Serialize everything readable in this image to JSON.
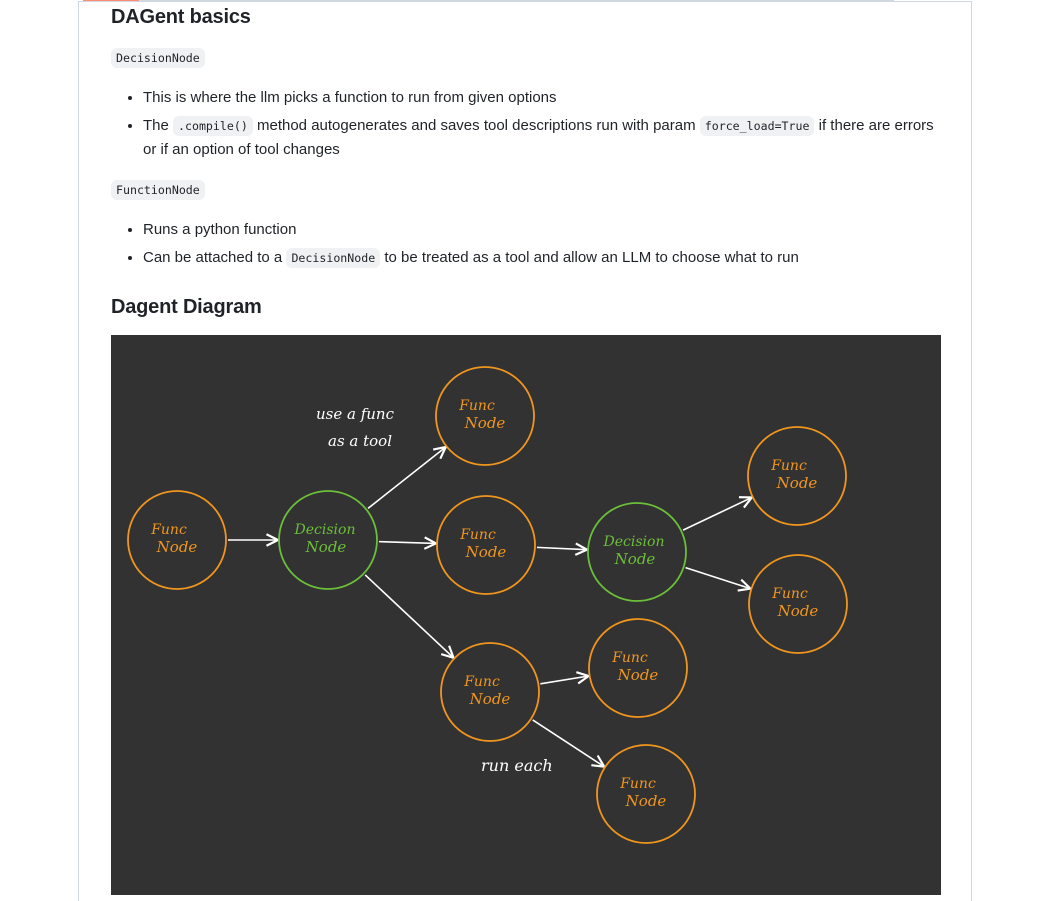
{
  "section": {
    "title": "DAGent basics",
    "decision_node": {
      "code": "DecisionNode",
      "bullets": [
        {
          "text": "This is where the llm picks a function to run from given options"
        },
        {
          "pre": "The ",
          "code1": ".compile()",
          "mid": " method autogenerates and saves tool descriptions run with param ",
          "code2": "force_load=True",
          "post": " if there are errors or if an option of tool changes"
        }
      ]
    },
    "function_node": {
      "code": "FunctionNode",
      "bullets": [
        {
          "text": "Runs a python function"
        },
        {
          "pre": "Can be attached to a ",
          "code1": "DecisionNode",
          "post": " to be treated as a tool and allow an LLM to choose what to run"
        }
      ]
    }
  },
  "diagram": {
    "title": "Dagent Diagram",
    "colors": {
      "background": "#323232",
      "func_node": "#f0961e",
      "decision_node": "#6cbf3a",
      "arrow": "#ffffff"
    },
    "nodes": [
      {
        "id": "f1",
        "type": "func",
        "line1": "Func",
        "line2": "Node"
      },
      {
        "id": "d1",
        "type": "decision",
        "line1": "Decision",
        "line2": "Node"
      },
      {
        "id": "f2",
        "type": "func",
        "line1": "Func",
        "line2": "Node"
      },
      {
        "id": "f3",
        "type": "func",
        "line1": "Func",
        "line2": "Node"
      },
      {
        "id": "f4",
        "type": "func",
        "line1": "Func",
        "line2": "Node"
      },
      {
        "id": "d2",
        "type": "decision",
        "line1": "Decision",
        "line2": "Node"
      },
      {
        "id": "f5",
        "type": "func",
        "line1": "Func",
        "line2": "Node"
      },
      {
        "id": "f6",
        "type": "func",
        "line1": "Func",
        "line2": "Node"
      },
      {
        "id": "f7",
        "type": "func",
        "line1": "Func",
        "line2": "Node"
      },
      {
        "id": "f8",
        "type": "func",
        "line1": "Func",
        "line2": "Node"
      }
    ],
    "edges": [
      {
        "from": "f1",
        "to": "d1"
      },
      {
        "from": "d1",
        "to": "f2"
      },
      {
        "from": "d1",
        "to": "f3"
      },
      {
        "from": "d1",
        "to": "f4"
      },
      {
        "from": "f3",
        "to": "d2"
      },
      {
        "from": "d2",
        "to": "f5"
      },
      {
        "from": "d2",
        "to": "f6"
      },
      {
        "from": "f4",
        "to": "f7"
      },
      {
        "from": "f4",
        "to": "f8"
      }
    ],
    "annotations": {
      "use_func_line1": "use a func",
      "use_func_line2": "as a tool",
      "run_each": "run each"
    }
  }
}
